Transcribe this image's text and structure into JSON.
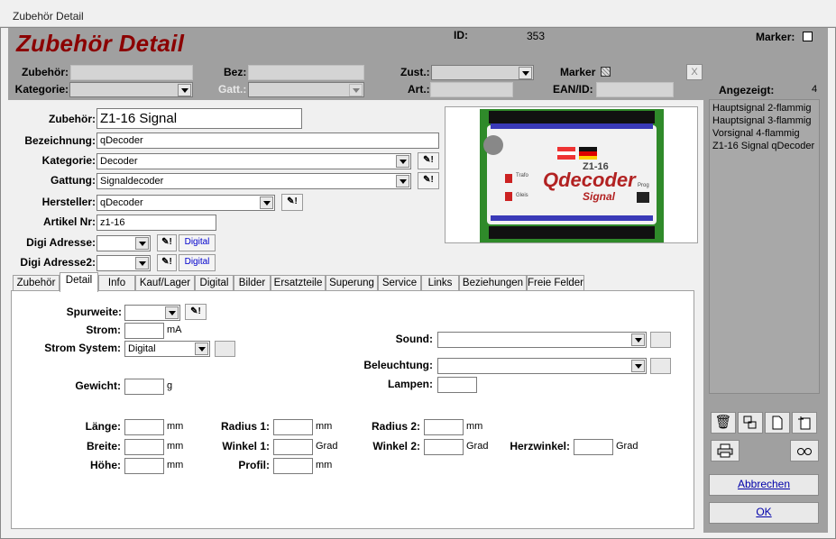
{
  "window": {
    "title": "Zubehör Detail"
  },
  "header": {
    "title": "Zubehör Detail",
    "id_label": "ID:",
    "id_value": "353",
    "marker_label": "Marker:"
  },
  "filter": {
    "zubehoer_label": "Zubehör:",
    "bez_label": "Bez:",
    "zust_label": "Zust.:",
    "marker_label": "Marker",
    "kategorie_label": "Kategorie:",
    "gatt_label": "Gatt.:",
    "art_label": "Art.:",
    "ean_label": "EAN/ID:",
    "close_label": "X"
  },
  "detail": {
    "zubehoer_label": "Zubehör:",
    "zubehoer_value": "Z1-16 Signal",
    "bezeichnung_label": "Bezeichnung:",
    "bezeichnung_value": "qDecoder",
    "kategorie_label": "Kategorie:",
    "kategorie_value": "Decoder",
    "gattung_label": "Gattung:",
    "gattung_value": "Signaldecoder",
    "hersteller_label": "Hersteller:",
    "hersteller_value": "qDecoder",
    "artikel_label": "Artikel Nr:",
    "artikel_value": "z1-16",
    "digi_label": "Digi Adresse:",
    "digi2_label": "Digi Adresse2:",
    "digital_button": "Digital",
    "edit_icon": "✎!"
  },
  "photo": {
    "board_label": "Z1-16",
    "brand": "Qdecoder",
    "sub": "Signal",
    "side1": "Trafo",
    "side2": "Gleis",
    "prog": "Prog",
    "colors": {
      "board": "#f2f2f2",
      "pcb": "#2f8a2a",
      "brand": "#b22222"
    }
  },
  "tabs": [
    "Zubehör",
    "Detail",
    "Info",
    "Kauf/Lager",
    "Digital",
    "Bilder",
    "Ersatzteile",
    "Superung",
    "Service",
    "Links",
    "Beziehungen",
    "Freie Felder"
  ],
  "active_tab": "Detail",
  "tab_detail": {
    "spurweite_label": "Spurweite:",
    "strom_label": "Strom:",
    "strom_unit": "mA",
    "stromsystem_label": "Strom System:",
    "stromsystem_value": "Digital",
    "sound_label": "Sound:",
    "beleuchtung_label": "Beleuchtung:",
    "lampen_label": "Lampen:",
    "gewicht_label": "Gewicht:",
    "gewicht_unit": "g",
    "laenge_label": "Länge:",
    "breite_label": "Breite:",
    "hoehe_label": "Höhe:",
    "radius1_label": "Radius 1:",
    "winkel1_label": "Winkel 1:",
    "profil_label": "Profil:",
    "radius2_label": "Radius 2:",
    "winkel2_label": "Winkel 2:",
    "herzwinkel_label": "Herzwinkel:",
    "mm": "mm",
    "grad": "Grad"
  },
  "side": {
    "angezeigt_label": "Angezeigt:",
    "angezeigt_count": "4",
    "items": [
      "Hauptsignal 2-flammig",
      "Hauptsignal 3-flammig",
      "Vorsignal 4-flammig",
      "Z1-16 Signal qDecoder"
    ],
    "abbrechen": "Abbrechen",
    "ok": "OK"
  }
}
